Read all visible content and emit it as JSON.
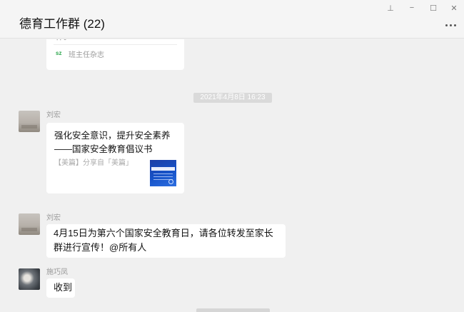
{
  "window": {
    "title": "德育工作群 (22)",
    "controls": {
      "pin_glyph": "⊥",
      "minimize_glyph": "−",
      "maximize_glyph": "☐",
      "close_glyph": "✕"
    },
    "more_icon": "more-dots-icon"
  },
  "chat": {
    "top_card": {
      "snippet": "体。",
      "source_name": "班主任杂志",
      "source_icon_text": "sz"
    },
    "timestamp": "2021年4月8日 16:23",
    "messages": [
      {
        "sender": "刘宏",
        "type": "link",
        "title": "强化安全意识，提升安全素养——国家安全教育倡议书",
        "description": "【美篇】分享自「美篇」"
      },
      {
        "sender": "刘宏",
        "type": "text",
        "text": "4月15日为第六个国家安全教育日，请各位转发至家长群进行宣传！@所有人"
      },
      {
        "sender": "施巧凤",
        "type": "text",
        "text": "收到"
      }
    ]
  }
}
